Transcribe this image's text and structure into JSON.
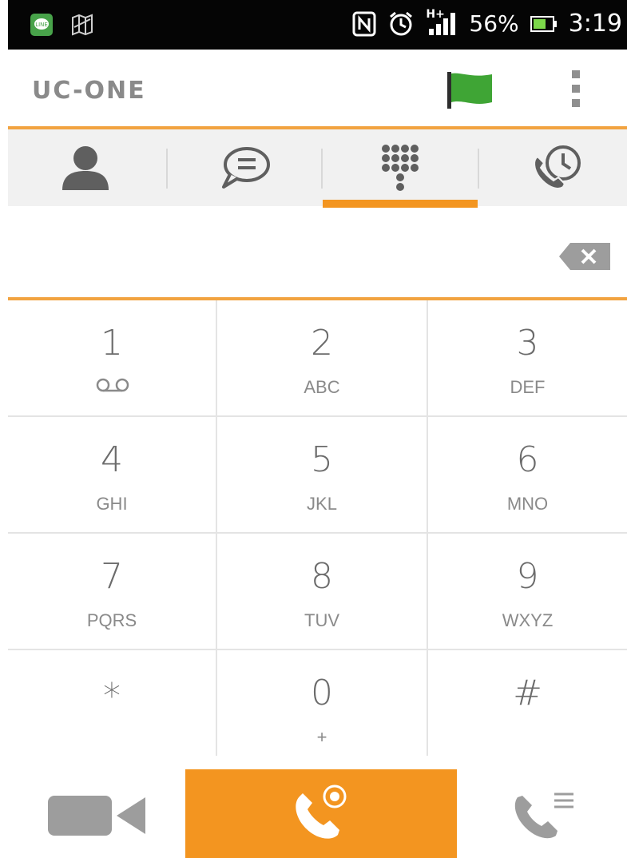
{
  "status_bar": {
    "battery_percent": "56%",
    "time": "3:19",
    "network_label": "H+",
    "icons": [
      "line-app-icon",
      "map-icon",
      "nfc-icon",
      "alarm-icon",
      "signal-icon",
      "battery-icon"
    ]
  },
  "app": {
    "title": "UC-ONE",
    "flag_color": "#3fa535",
    "accent_color": "#f39520"
  },
  "tabs": [
    {
      "name": "contacts",
      "icon": "contact-icon"
    },
    {
      "name": "chat",
      "icon": "chat-icon"
    },
    {
      "name": "dialpad",
      "icon": "dialpad-icon",
      "selected": true
    },
    {
      "name": "call-history",
      "icon": "call-history-icon"
    }
  ],
  "number_input": {
    "value": ""
  },
  "keypad": {
    "keys": [
      {
        "digit": "1",
        "letters": ""
      },
      {
        "digit": "2",
        "letters": "ABC"
      },
      {
        "digit": "3",
        "letters": "DEF"
      },
      {
        "digit": "4",
        "letters": "GHI"
      },
      {
        "digit": "5",
        "letters": "JKL"
      },
      {
        "digit": "6",
        "letters": "MNO"
      },
      {
        "digit": "7",
        "letters": "PQRS"
      },
      {
        "digit": "8",
        "letters": "TUV"
      },
      {
        "digit": "9",
        "letters": "WXYZ"
      },
      {
        "digit": "*",
        "letters": ""
      },
      {
        "digit": "0",
        "letters": "+"
      },
      {
        "digit": "#",
        "letters": ""
      }
    ]
  },
  "bottom_bar": {
    "icons": [
      "video-call-icon",
      "call-icon",
      "call-list-icon"
    ]
  }
}
